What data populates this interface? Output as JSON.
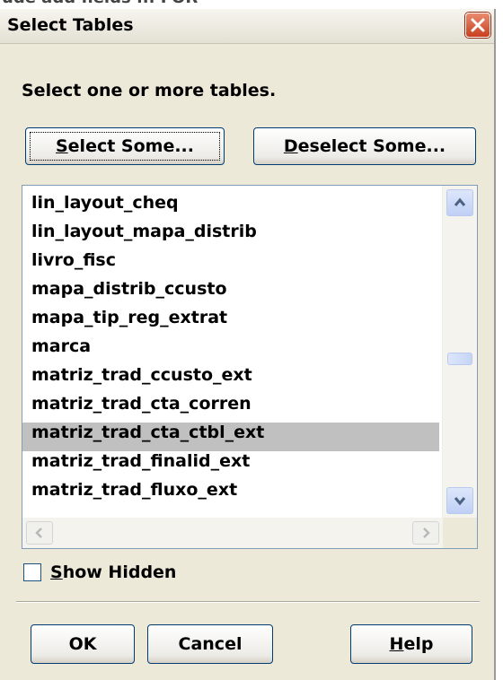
{
  "window": {
    "top_partial_text": "ude add fields ... FOR",
    "title": "Select Tables"
  },
  "instruction": "Select one or more tables.",
  "buttons": {
    "select_some": {
      "mnemonic": "S",
      "rest": "elect Some..."
    },
    "deselect_some": {
      "mnemonic": "D",
      "rest": "eselect Some..."
    },
    "ok": "OK",
    "cancel": "Cancel",
    "help": {
      "mnemonic": "H",
      "rest": "elp"
    }
  },
  "tables": {
    "items": [
      "lin_layout_cheq",
      "lin_layout_mapa_distrib",
      "livro_fisc",
      "mapa_distrib_ccusto",
      "mapa_tip_reg_extrat",
      "marca",
      "matriz_trad_ccusto_ext",
      "matriz_trad_cta_corren",
      "matriz_trad_cta_ctbl_ext",
      "matriz_trad_finalid_ext",
      "matriz_trad_fluxo_ext"
    ],
    "selected_item": "matriz_trad_cta_ctbl_ext"
  },
  "show_hidden": {
    "mnemonic": "S",
    "rest": "how Hidden",
    "checked": false
  },
  "colors": {
    "dialog_bg": "#ece9d8",
    "close_button": "#c8401f",
    "button_border": "#003c74",
    "list_border": "#7f9db9",
    "selection_bg": "#c0c0c0"
  },
  "icons": {
    "close": "close-x-icon",
    "scroll_up": "chevron-up-icon",
    "scroll_down": "chevron-down-icon",
    "scroll_left": "chevron-left-icon",
    "scroll_right": "chevron-right-icon"
  }
}
